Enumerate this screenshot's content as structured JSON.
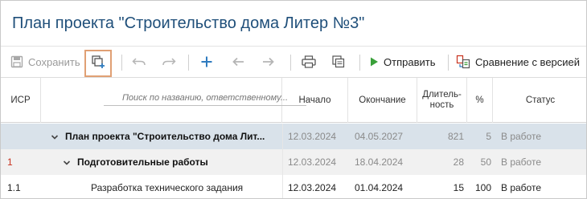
{
  "title": "План проекта \"Строительство дома Литер №3\"",
  "toolbar": {
    "save_label": "Сохранить",
    "send_label": "Отправить",
    "compare_label": "Сравнение с версией"
  },
  "columns": {
    "isr": "ИСР",
    "search_placeholder": "Поиск по названию, ответственному...",
    "start": "Начало",
    "end": "Окончание",
    "duration": "Длитель-\nность",
    "percent": "%",
    "status": "Статус"
  },
  "rows": [
    {
      "isr": "",
      "name": "План проекта \"Строительство дома Лит...",
      "start": "12.03.2024",
      "end": "04.05.2027",
      "duration": "821",
      "percent": "5",
      "status": "В работе"
    },
    {
      "isr": "1",
      "name": "Подготовительные работы",
      "start": "12.03.2024",
      "end": "18.04.2024",
      "duration": "28",
      "percent": "50",
      "status": "В работе"
    },
    {
      "isr": "1.1",
      "name": "Разработка технического задания",
      "start": "12.03.2024",
      "end": "01.04.2024",
      "duration": "15",
      "percent": "100",
      "status": "В работе"
    }
  ],
  "colors": {
    "title": "#1f4f7a",
    "accent_blue": "#2f7bbf",
    "send_green": "#3aa03a",
    "highlight_orange": "#e0a074",
    "selected_row": "#d9e2ea",
    "isr_red": "#c8321e"
  },
  "icons": [
    "save-icon",
    "copy-add-icon",
    "undo-icon",
    "redo-icon",
    "add-icon",
    "arrow-left-icon",
    "arrow-right-icon",
    "print-icon",
    "copy-icon",
    "play-icon",
    "compare-icon",
    "chevron-down-icon"
  ]
}
